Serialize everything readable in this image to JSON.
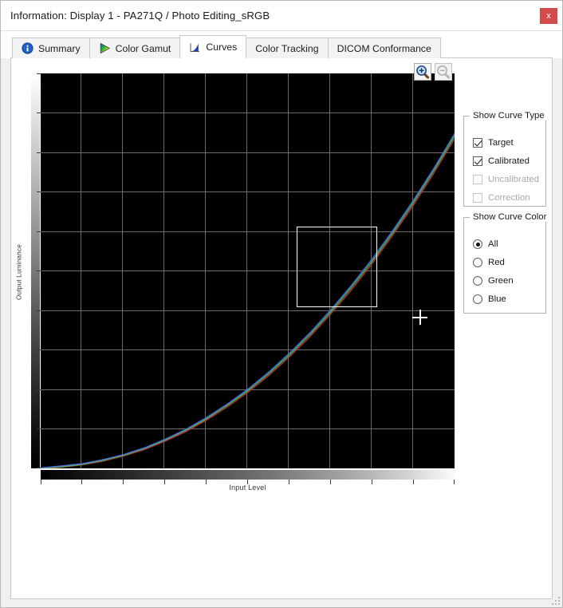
{
  "window": {
    "title": "Information: Display 1 - PA271Q / Photo Editing_sRGB",
    "close_label": "x"
  },
  "tabs": [
    {
      "label": "Summary",
      "icon": "info-icon",
      "active": false
    },
    {
      "label": "Color Gamut",
      "icon": "gamut-triangle-icon",
      "active": false
    },
    {
      "label": "Curves",
      "icon": "curve-chart-icon",
      "active": true
    },
    {
      "label": "Color Tracking",
      "icon": "",
      "active": false
    },
    {
      "label": "DICOM Conformance",
      "icon": "",
      "active": false
    }
  ],
  "toolbar": {
    "zoom_in_label": "Zoom In",
    "zoom_out_label": "Zoom Out"
  },
  "curve_type_group": {
    "title": "Show Curve Type",
    "options": [
      {
        "label": "Target",
        "checked": true,
        "enabled": true
      },
      {
        "label": "Calibrated",
        "checked": true,
        "enabled": true
      },
      {
        "label": "Uncalibrated",
        "checked": false,
        "enabled": false
      },
      {
        "label": "Correction",
        "checked": false,
        "enabled": false
      }
    ]
  },
  "curve_color_group": {
    "title": "Show Curve Color",
    "selected": "All",
    "options": [
      {
        "label": "All",
        "selected": true
      },
      {
        "label": "Red",
        "selected": false
      },
      {
        "label": "Green",
        "selected": false
      },
      {
        "label": "Blue",
        "selected": false
      }
    ]
  },
  "colors": {
    "accent": "#2a5db0",
    "close_button": "#d44b4b",
    "plot_background": "#000000",
    "gridline": "#6c6c6c",
    "curve_red": "#c83232",
    "curve_green": "#32c850",
    "curve_blue": "#5a6ee6",
    "selection_outline": "#ffffff",
    "crosshair": "#ffffff"
  },
  "chart_data": {
    "type": "line",
    "title": "",
    "xlabel": "Input Level",
    "ylabel": "Output Luminance",
    "xlim": [
      0,
      100
    ],
    "ylim": [
      0,
      100
    ],
    "grid": true,
    "legend": "none",
    "x_gridlines": [
      10,
      20,
      30,
      40,
      50,
      60,
      70,
      80,
      90
    ],
    "y_gridlines": [
      10,
      20,
      30,
      40,
      50,
      60,
      70,
      80,
      90
    ],
    "x_ticks": [
      0,
      10,
      20,
      30,
      40,
      50,
      60,
      70,
      80,
      90,
      100
    ],
    "y_ticks": [
      0,
      10,
      20,
      30,
      40,
      50,
      60,
      70,
      80,
      90,
      100
    ],
    "x_tick_labels": [],
    "y_tick_labels": [],
    "x": [
      0,
      5,
      10,
      15,
      20,
      25,
      30,
      35,
      40,
      45,
      50,
      55,
      60,
      65,
      70,
      75,
      80,
      85,
      90,
      95,
      100
    ],
    "series": [
      {
        "name": "Red",
        "color": "#c83232",
        "values": [
          0.0,
          0.4,
          1.0,
          1.9,
          3.2,
          4.8,
          6.9,
          9.3,
          12.2,
          15.5,
          19.2,
          23.4,
          28.1,
          33.2,
          38.9,
          45.0,
          51.6,
          58.8,
          66.4,
          74.6,
          83.3
        ]
      },
      {
        "name": "Green",
        "color": "#32c850",
        "values": [
          0.0,
          0.4,
          1.0,
          2.0,
          3.3,
          5.0,
          7.1,
          9.6,
          12.5,
          15.9,
          19.6,
          23.9,
          28.6,
          33.8,
          39.5,
          45.7,
          52.3,
          59.5,
          67.2,
          75.4,
          84.1
        ]
      },
      {
        "name": "Blue",
        "color": "#5a6ee6",
        "values": [
          0.0,
          0.5,
          1.1,
          2.1,
          3.4,
          5.1,
          7.3,
          9.8,
          12.8,
          16.2,
          20.0,
          24.3,
          29.1,
          34.3,
          40.1,
          46.3,
          53.0,
          60.2,
          67.9,
          76.1,
          84.9
        ]
      }
    ],
    "annotations": [
      {
        "type": "selection-rectangle",
        "x0": 62,
        "x1": 81,
        "y0": 41,
        "y1": 60
      },
      {
        "type": "crosshair-cursor",
        "x": 90,
        "y": 39
      }
    ]
  }
}
